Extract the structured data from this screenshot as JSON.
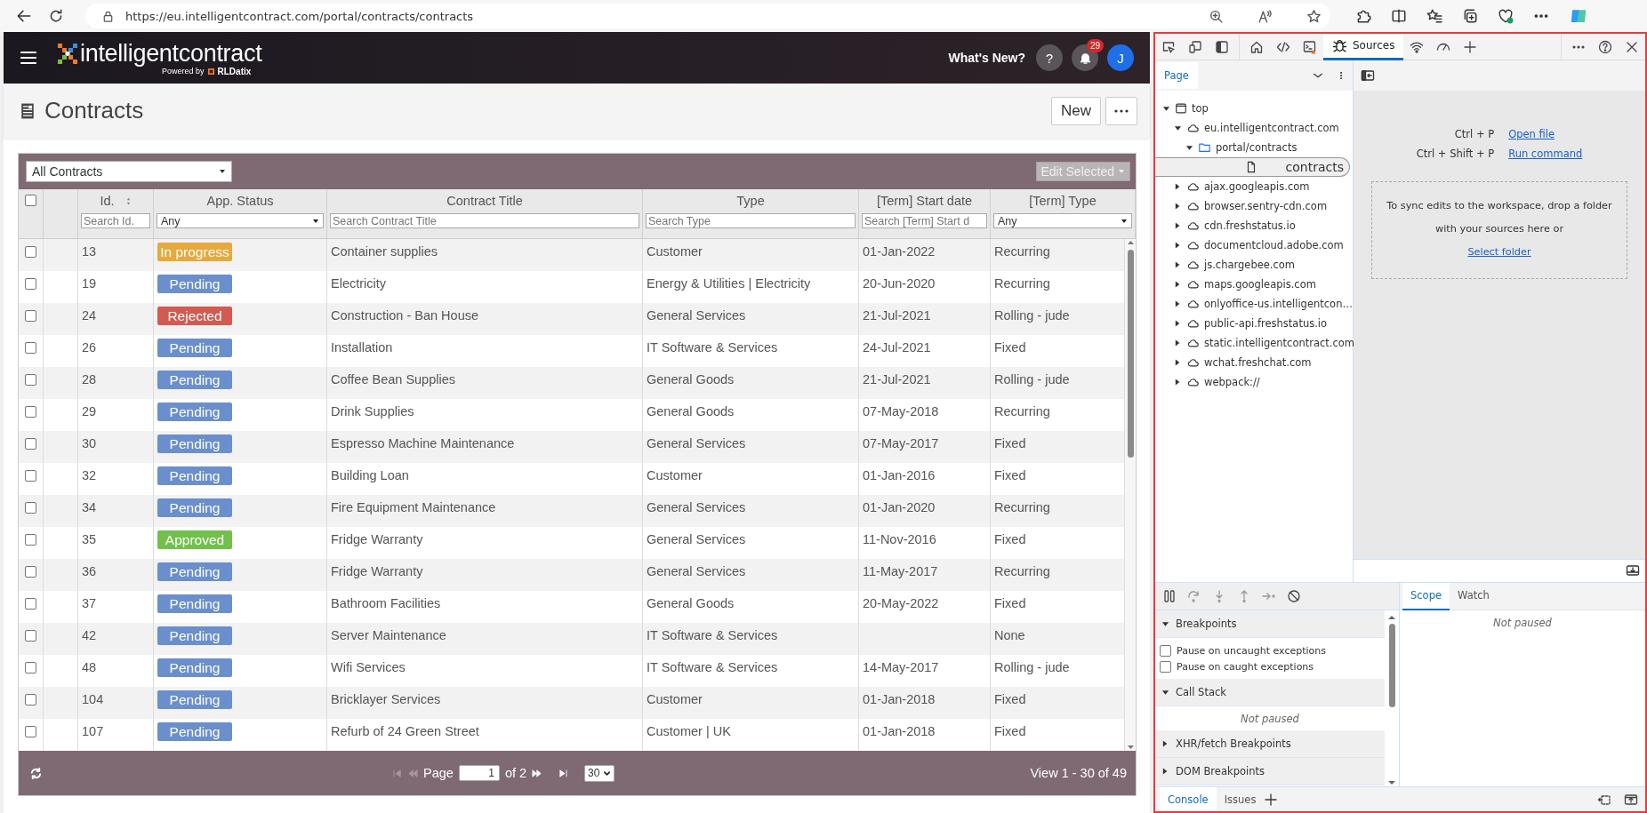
{
  "browser": {
    "url": "https://eu.intelligentcontract.com/portal/contracts/contracts"
  },
  "app_header": {
    "logo": "intelligentcontract",
    "tagline": "Powered by",
    "tagline_brand": "RLDatix",
    "whats_new": "What's New?",
    "help": "?",
    "notifications": "29",
    "avatar": "J"
  },
  "page": {
    "title": "Contracts",
    "new_button": "New"
  },
  "grid": {
    "view_select": "All Contracts",
    "edit_selected": {
      "label": "Edit Selected",
      "disabled": true
    },
    "columns": [
      {
        "kind": "check",
        "checked": false
      },
      {
        "kind": "blank"
      },
      {
        "kind": "text",
        "label": "Id.",
        "placeholder": "Search Id.",
        "sortable": true
      },
      {
        "kind": "text",
        "label": "App. Status",
        "select": "Any"
      },
      {
        "kind": "text",
        "label": "Contract Title",
        "placeholder": "Search Contract Title"
      },
      {
        "kind": "text",
        "label": "Type",
        "placeholder": "Search Type"
      },
      {
        "kind": "text",
        "label": "[Term] Start date",
        "placeholder": "Search [Term] Start d"
      },
      {
        "kind": "text",
        "label": "[Term] Type",
        "select": "Any"
      }
    ],
    "rows": [
      {
        "checked": false,
        "id": "13",
        "status": {
          "label": "In progress",
          "color": "#e6a93d"
        },
        "title": "Container supplies",
        "type": "Customer",
        "start": "01-Jan-2022",
        "term_type": "Recurring"
      },
      {
        "checked": false,
        "id": "19",
        "status": {
          "label": "Pending",
          "color": "#6b8fcc"
        },
        "title": "Electricity",
        "type": "Energy & Utilities | Electricity",
        "start": "20-Jun-2020",
        "term_type": "Recurring"
      },
      {
        "checked": false,
        "id": "24",
        "status": {
          "label": "Rejected",
          "color": "#d25a50"
        },
        "title": "Construction - Ban House",
        "type": "General Services",
        "start": "21-Jul-2021",
        "term_type": "Rolling - jude"
      },
      {
        "checked": false,
        "id": "26",
        "status": {
          "label": "Pending",
          "color": "#6b8fcc"
        },
        "title": "Installation",
        "type": "IT Software & Services",
        "start": "24-Jul-2021",
        "term_type": "Fixed"
      },
      {
        "checked": false,
        "id": "28",
        "status": {
          "label": "Pending",
          "color": "#6b8fcc"
        },
        "title": "Coffee Bean Supplies",
        "type": "General Goods",
        "start": "21-Jul-2021",
        "term_type": "Rolling - jude"
      },
      {
        "checked": false,
        "id": "29",
        "status": {
          "label": "Pending",
          "color": "#6b8fcc"
        },
        "title": "Drink Supplies",
        "type": "General Goods",
        "start": "07-May-2018",
        "term_type": "Recurring"
      },
      {
        "checked": false,
        "id": "30",
        "status": {
          "label": "Pending",
          "color": "#6b8fcc"
        },
        "title": "Espresso Machine Maintenance",
        "type": "General Services",
        "start": "07-May-2017",
        "term_type": "Fixed"
      },
      {
        "checked": false,
        "id": "32",
        "status": {
          "label": "Pending",
          "color": "#6b8fcc"
        },
        "title": "Building Loan",
        "type": "Customer",
        "start": "01-Jan-2016",
        "term_type": "Fixed"
      },
      {
        "checked": false,
        "id": "34",
        "status": {
          "label": "Pending",
          "color": "#6b8fcc"
        },
        "title": "Fire Equipment Maintenance",
        "type": "General Services",
        "start": "01-Jan-2020",
        "term_type": "Recurring"
      },
      {
        "checked": false,
        "id": "35",
        "status": {
          "label": "Approved",
          "color": "#72c04c"
        },
        "title": "Fridge Warranty",
        "type": "General Services",
        "start": "11-Nov-2016",
        "term_type": "Fixed"
      },
      {
        "checked": false,
        "id": "36",
        "status": {
          "label": "Pending",
          "color": "#6b8fcc"
        },
        "title": "Fridge Warranty",
        "type": "General Services",
        "start": "11-May-2017",
        "term_type": "Recurring"
      },
      {
        "checked": false,
        "id": "37",
        "status": {
          "label": "Pending",
          "color": "#6b8fcc"
        },
        "title": "Bathroom Facilities",
        "type": "General Goods",
        "start": "20-May-2022",
        "term_type": "Fixed"
      },
      {
        "checked": false,
        "id": "42",
        "status": {
          "label": "Pending",
          "color": "#6b8fcc"
        },
        "title": "Server Maintenance",
        "type": "IT Software & Services",
        "term_type": "None"
      },
      {
        "checked": false,
        "id": "48",
        "status": {
          "label": "Pending",
          "color": "#6b8fcc"
        },
        "title": "Wifi Services",
        "type": "IT Software & Services",
        "start": "14-May-2017",
        "term_type": "Rolling - jude"
      },
      {
        "checked": false,
        "id": "104",
        "status": {
          "label": "Pending",
          "color": "#6b8fcc"
        },
        "title": "Bricklayer Services",
        "type": "Customer",
        "start": "01-Jan-2018",
        "term_type": "Fixed"
      },
      {
        "checked": false,
        "id": "107",
        "status": {
          "label": "Pending",
          "color": "#6b8fcc"
        },
        "title": "Refurb of 24 Green Street",
        "type": "Customer | UK",
        "start": "01-Jan-2018",
        "term_type": "Fixed"
      }
    ],
    "pager": {
      "page_label": "Page",
      "page": "1",
      "of": "of 2",
      "page_size": "30",
      "view": "View 1 - 30 of 49"
    }
  },
  "devtools": {
    "sources_tab": {
      "label": "Sources",
      "selected": true
    },
    "navigator": {
      "tab": {
        "label": "Page",
        "selected": true
      },
      "tree": [
        {
          "label": "top",
          "kind": "frame",
          "expanded": true,
          "selected": false,
          "children": [
            {
              "label": "eu.intelligentcontract.com",
              "kind": "domain",
              "expanded": true,
              "selected": false,
              "children": [
                {
                  "label": "portal/contracts",
                  "kind": "folder",
                  "expanded": true,
                  "selected": false,
                  "children": [
                    {
                      "label": "contracts",
                      "kind": "file",
                      "selected": true
                    }
                  ]
                }
              ]
            },
            {
              "label": "ajax.googleapis.com",
              "kind": "domain",
              "expanded": false,
              "selected": false
            },
            {
              "label": "browser.sentry-cdn.com",
              "kind": "domain",
              "expanded": false,
              "selected": false
            },
            {
              "label": "cdn.freshstatus.io",
              "kind": "domain",
              "expanded": false,
              "selected": false
            },
            {
              "label": "documentcloud.adobe.com",
              "kind": "domain",
              "expanded": false,
              "selected": false
            },
            {
              "label": "js.chargebee.com",
              "kind": "domain",
              "expanded": false,
              "selected": false
            },
            {
              "label": "maps.googleapis.com",
              "kind": "domain",
              "expanded": false,
              "selected": false
            },
            {
              "label": "onlyoffice-us.intelligentcon…",
              "kind": "domain",
              "expanded": false,
              "selected": false
            },
            {
              "label": "public-api.freshstatus.io",
              "kind": "domain",
              "expanded": false,
              "selected": false
            },
            {
              "label": "static.intelligentcontract.com",
              "kind": "domain",
              "expanded": false,
              "selected": false
            },
            {
              "label": "wchat.freshchat.com",
              "kind": "domain",
              "expanded": false,
              "selected": false
            },
            {
              "label": "webpack://",
              "kind": "domain",
              "expanded": false,
              "selected": false
            }
          ]
        }
      ]
    },
    "editor": {
      "shortcuts": [
        {
          "keys": "Ctrl + P",
          "action": "Open file"
        },
        {
          "keys": "Ctrl + Shift + P",
          "action": "Run command"
        }
      ],
      "drop_text": "To sync edits to the workspace, drop a folder with your sources here or",
      "drop_link": "Select folder"
    },
    "debugger": {
      "sections": [
        {
          "label": "Breakpoints",
          "expanded": true,
          "kind": "checks",
          "items": [
            {
              "label": "Pause on uncaught exceptions",
              "checked": false
            },
            {
              "label": "Pause on caught exceptions",
              "checked": false
            }
          ]
        },
        {
          "label": "Call Stack",
          "expanded": true,
          "kind": "message",
          "message": "Not paused"
        },
        {
          "label": "XHR/fetch Breakpoints",
          "expanded": false
        },
        {
          "label": "DOM Breakpoints",
          "expanded": false
        }
      ],
      "side_tabs": [
        {
          "label": "Scope",
          "selected": true
        },
        {
          "label": "Watch",
          "selected": false
        }
      ],
      "side_message": "Not paused"
    },
    "drawer_tabs": [
      {
        "label": "Console",
        "selected": true
      },
      {
        "label": "Issues",
        "selected": false
      }
    ]
  }
}
